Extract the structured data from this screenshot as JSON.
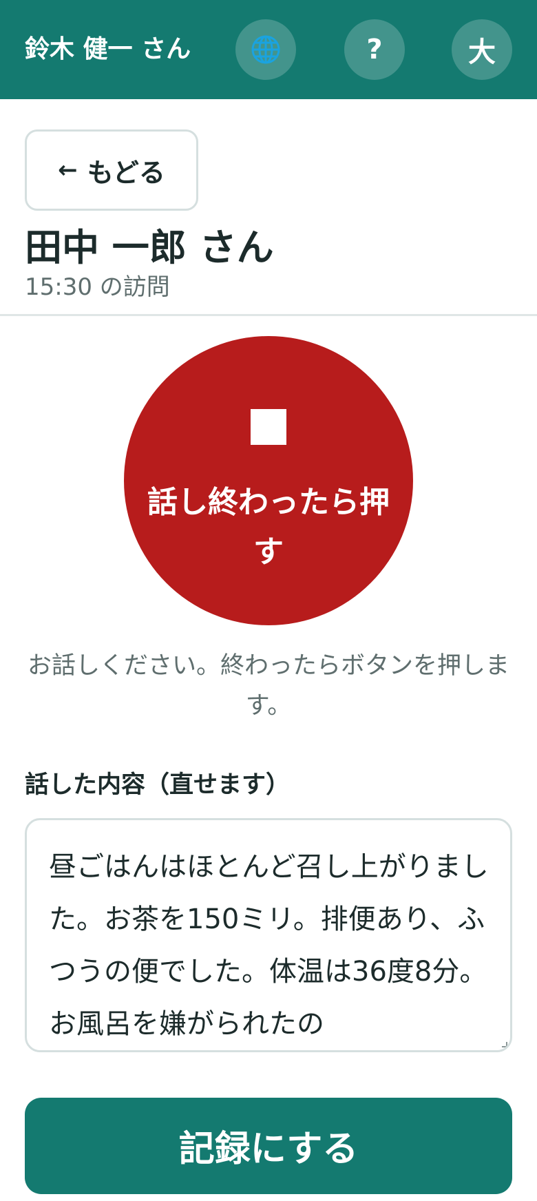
{
  "header": {
    "user_name": "鈴木 健一 さん",
    "language_button_icon": "globe-icon",
    "language_button_glyph": "🌐",
    "help_button_label": "?",
    "large_text_button_label": "大"
  },
  "back_button": {
    "arrow": "←",
    "label": "もどる"
  },
  "visit": {
    "client_name": "田中 一郎 さん",
    "time_label": "15:30 の訪問"
  },
  "recording": {
    "state": "recording",
    "stop_icon": "stop-square-icon",
    "button_label": "話し終わったら押す",
    "instruction": "お話しください。終わったらボタンを押します。"
  },
  "transcript": {
    "label": "話した内容（直せます）",
    "text": "昼ごはんはほとんど召し上がりました。お茶を150ミリ。排便あり、ふつうの便でした。体温は36度8分。お風呂を嫌がられたの"
  },
  "save_button": {
    "label": "記録にする"
  },
  "colors": {
    "primary": "#147a70",
    "record_red": "#b71c1c",
    "text": "#1c2b2b",
    "muted_text": "#5f6e6e",
    "border": "#d5dfdf"
  }
}
